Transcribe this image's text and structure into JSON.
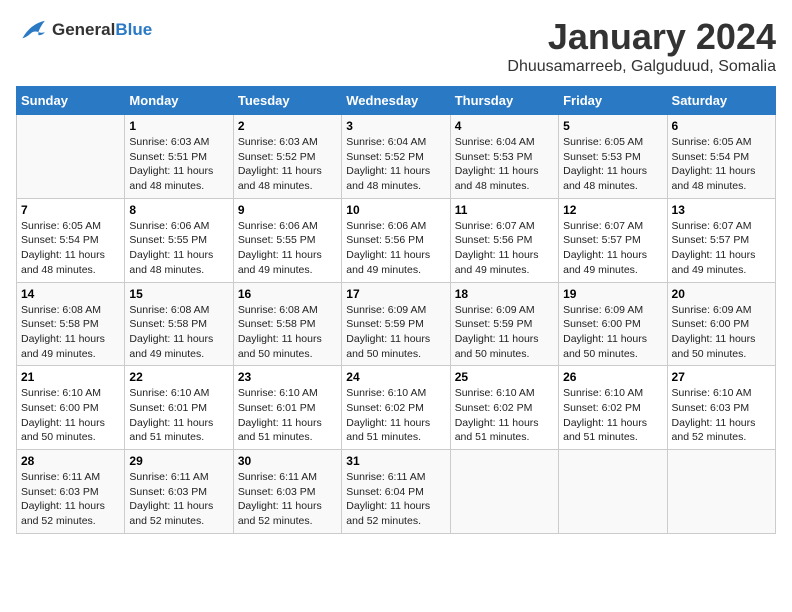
{
  "header": {
    "logo_line1": "General",
    "logo_line2": "Blue",
    "month": "January 2024",
    "location": "Dhuusamarreeb, Galguduud, Somalia"
  },
  "days_of_week": [
    "Sunday",
    "Monday",
    "Tuesday",
    "Wednesday",
    "Thursday",
    "Friday",
    "Saturday"
  ],
  "weeks": [
    [
      {
        "num": "",
        "info": ""
      },
      {
        "num": "1",
        "info": "Sunrise: 6:03 AM\nSunset: 5:51 PM\nDaylight: 11 hours and 48 minutes."
      },
      {
        "num": "2",
        "info": "Sunrise: 6:03 AM\nSunset: 5:52 PM\nDaylight: 11 hours and 48 minutes."
      },
      {
        "num": "3",
        "info": "Sunrise: 6:04 AM\nSunset: 5:52 PM\nDaylight: 11 hours and 48 minutes."
      },
      {
        "num": "4",
        "info": "Sunrise: 6:04 AM\nSunset: 5:53 PM\nDaylight: 11 hours and 48 minutes."
      },
      {
        "num": "5",
        "info": "Sunrise: 6:05 AM\nSunset: 5:53 PM\nDaylight: 11 hours and 48 minutes."
      },
      {
        "num": "6",
        "info": "Sunrise: 6:05 AM\nSunset: 5:54 PM\nDaylight: 11 hours and 48 minutes."
      }
    ],
    [
      {
        "num": "7",
        "info": "Sunrise: 6:05 AM\nSunset: 5:54 PM\nDaylight: 11 hours and 48 minutes."
      },
      {
        "num": "8",
        "info": "Sunrise: 6:06 AM\nSunset: 5:55 PM\nDaylight: 11 hours and 48 minutes."
      },
      {
        "num": "9",
        "info": "Sunrise: 6:06 AM\nSunset: 5:55 PM\nDaylight: 11 hours and 49 minutes."
      },
      {
        "num": "10",
        "info": "Sunrise: 6:06 AM\nSunset: 5:56 PM\nDaylight: 11 hours and 49 minutes."
      },
      {
        "num": "11",
        "info": "Sunrise: 6:07 AM\nSunset: 5:56 PM\nDaylight: 11 hours and 49 minutes."
      },
      {
        "num": "12",
        "info": "Sunrise: 6:07 AM\nSunset: 5:57 PM\nDaylight: 11 hours and 49 minutes."
      },
      {
        "num": "13",
        "info": "Sunrise: 6:07 AM\nSunset: 5:57 PM\nDaylight: 11 hours and 49 minutes."
      }
    ],
    [
      {
        "num": "14",
        "info": "Sunrise: 6:08 AM\nSunset: 5:58 PM\nDaylight: 11 hours and 49 minutes."
      },
      {
        "num": "15",
        "info": "Sunrise: 6:08 AM\nSunset: 5:58 PM\nDaylight: 11 hours and 49 minutes."
      },
      {
        "num": "16",
        "info": "Sunrise: 6:08 AM\nSunset: 5:58 PM\nDaylight: 11 hours and 50 minutes."
      },
      {
        "num": "17",
        "info": "Sunrise: 6:09 AM\nSunset: 5:59 PM\nDaylight: 11 hours and 50 minutes."
      },
      {
        "num": "18",
        "info": "Sunrise: 6:09 AM\nSunset: 5:59 PM\nDaylight: 11 hours and 50 minutes."
      },
      {
        "num": "19",
        "info": "Sunrise: 6:09 AM\nSunset: 6:00 PM\nDaylight: 11 hours and 50 minutes."
      },
      {
        "num": "20",
        "info": "Sunrise: 6:09 AM\nSunset: 6:00 PM\nDaylight: 11 hours and 50 minutes."
      }
    ],
    [
      {
        "num": "21",
        "info": "Sunrise: 6:10 AM\nSunset: 6:00 PM\nDaylight: 11 hours and 50 minutes."
      },
      {
        "num": "22",
        "info": "Sunrise: 6:10 AM\nSunset: 6:01 PM\nDaylight: 11 hours and 51 minutes."
      },
      {
        "num": "23",
        "info": "Sunrise: 6:10 AM\nSunset: 6:01 PM\nDaylight: 11 hours and 51 minutes."
      },
      {
        "num": "24",
        "info": "Sunrise: 6:10 AM\nSunset: 6:02 PM\nDaylight: 11 hours and 51 minutes."
      },
      {
        "num": "25",
        "info": "Sunrise: 6:10 AM\nSunset: 6:02 PM\nDaylight: 11 hours and 51 minutes."
      },
      {
        "num": "26",
        "info": "Sunrise: 6:10 AM\nSunset: 6:02 PM\nDaylight: 11 hours and 51 minutes."
      },
      {
        "num": "27",
        "info": "Sunrise: 6:10 AM\nSunset: 6:03 PM\nDaylight: 11 hours and 52 minutes."
      }
    ],
    [
      {
        "num": "28",
        "info": "Sunrise: 6:11 AM\nSunset: 6:03 PM\nDaylight: 11 hours and 52 minutes."
      },
      {
        "num": "29",
        "info": "Sunrise: 6:11 AM\nSunset: 6:03 PM\nDaylight: 11 hours and 52 minutes."
      },
      {
        "num": "30",
        "info": "Sunrise: 6:11 AM\nSunset: 6:03 PM\nDaylight: 11 hours and 52 minutes."
      },
      {
        "num": "31",
        "info": "Sunrise: 6:11 AM\nSunset: 6:04 PM\nDaylight: 11 hours and 52 minutes."
      },
      {
        "num": "",
        "info": ""
      },
      {
        "num": "",
        "info": ""
      },
      {
        "num": "",
        "info": ""
      }
    ]
  ]
}
